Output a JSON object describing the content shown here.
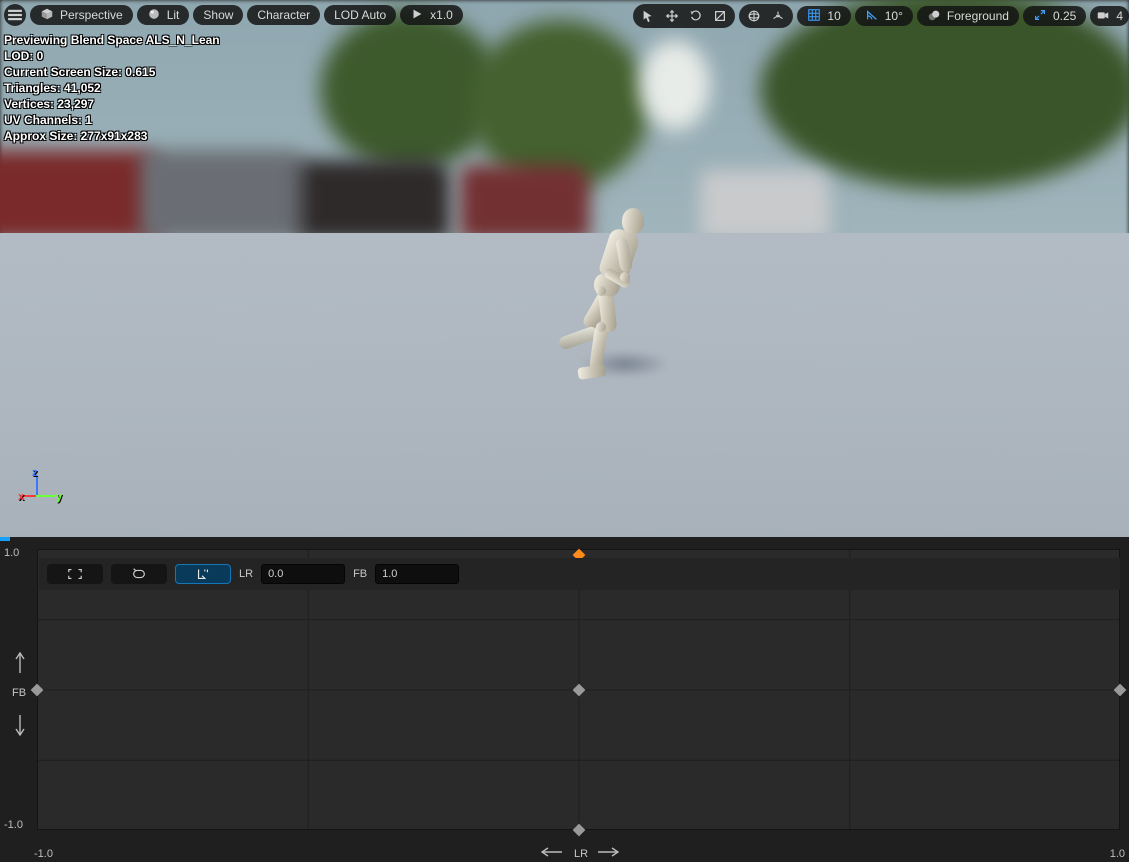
{
  "toolbar": {
    "menu_label": "",
    "perspective": "Perspective",
    "lit": "Lit",
    "show": "Show",
    "character": "Character",
    "lod": "LOD Auto",
    "speed": "x1.0",
    "grid_value": "10",
    "angle_value": "10°",
    "foreground": "Foreground",
    "camera_snap": "0.25",
    "camera_speed": "4"
  },
  "stats": {
    "line1": "Previewing Blend Space ALS_N_Lean",
    "line2": "LOD: 0",
    "line3": "Current Screen Size: 0.615",
    "line4": "Triangles: 41,052",
    "line5": "Vertices: 23,297",
    "line6": "UV Channels: 1",
    "line7": "Approx Size: 277x91x283"
  },
  "gizmo": {
    "x": "x",
    "y": "y",
    "z": "z"
  },
  "blend": {
    "y_top": "1.0",
    "y_bottom": "-1.0",
    "x_left": "-1.0",
    "x_right": "1.0",
    "y_axis_label": "FB",
    "x_axis_label": "LR",
    "lr_label": "LR",
    "lr_value": "0.0",
    "fb_label": "FB",
    "fb_value": "1.0"
  },
  "chart_data": {
    "type": "scatter",
    "title": "Blend Space ALS_N_Lean",
    "xlabel": "LR",
    "ylabel": "FB",
    "xlim": [
      -1.0,
      1.0
    ],
    "ylim": [
      -1.0,
      1.0
    ],
    "grid": true,
    "samples": [
      {
        "x": -1.0,
        "y": 0.0,
        "selected": false
      },
      {
        "x": 0.0,
        "y": 1.0,
        "selected": true
      },
      {
        "x": 0.0,
        "y": 0.0,
        "selected": false
      },
      {
        "x": 0.0,
        "y": -1.0,
        "selected": false
      },
      {
        "x": 1.0,
        "y": 0.0,
        "selected": false
      }
    ],
    "preview_point": {
      "x": 0.02,
      "y": 0.93
    }
  }
}
